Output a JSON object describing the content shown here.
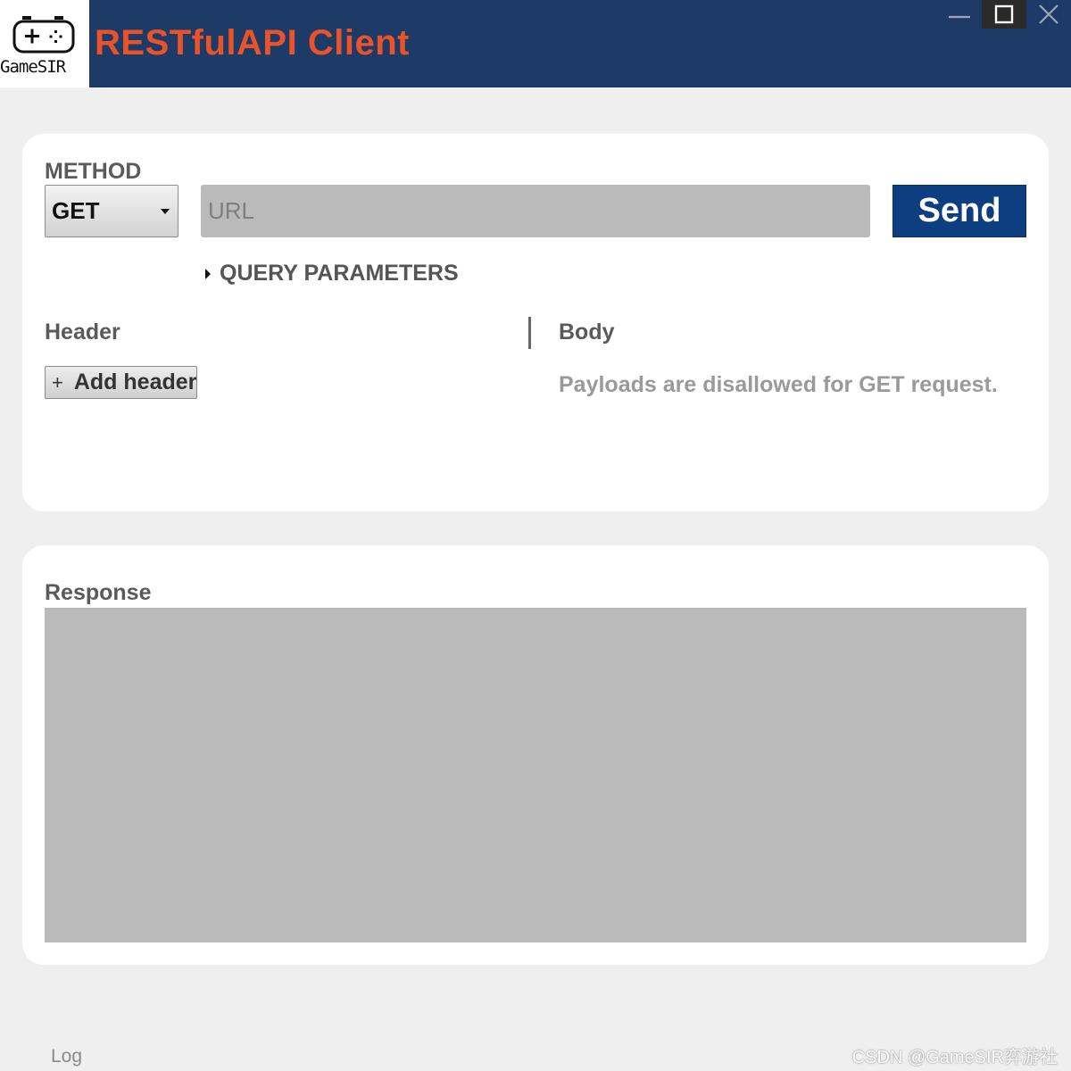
{
  "window": {
    "logo_text": "GameSIR",
    "title": "RESTfulAPI Client"
  },
  "request": {
    "method_label": "METHOD",
    "method_value": "GET",
    "url_placeholder": "URL",
    "send_label": "Send",
    "query_params_label": "QUERY PARAMETERS",
    "header_label": "Header",
    "add_header_label": "Add header",
    "body_label": "Body",
    "body_message": "Payloads are disallowed for GET request."
  },
  "response": {
    "label": "Response",
    "content": ""
  },
  "footer": {
    "log_label": "Log",
    "watermark": "CSDN @GameSIR弈游社"
  },
  "colors": {
    "titlebar": "#1e3a66",
    "title_text": "#e8532a",
    "send_button": "#0d3f80"
  },
  "icons": [
    "gamepad-logo-icon",
    "minimize-icon",
    "maximize-icon",
    "close-icon",
    "caret-down-icon",
    "triangle-right-icon",
    "plus-icon"
  ]
}
